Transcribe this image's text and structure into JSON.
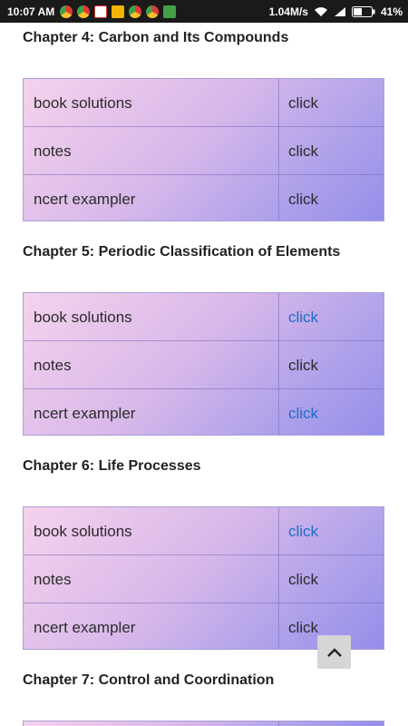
{
  "status_bar": {
    "time": "10:07 AM",
    "speed": "1.04M/s",
    "battery": "41%",
    "icons": [
      "chrome-icon",
      "chrome-icon",
      "gmail-icon",
      "mail-icon",
      "chrome-icon",
      "chrome-icon",
      "updates-icon"
    ]
  },
  "chapters": [
    {
      "title": "Chapter 4: Carbon and Its Compounds",
      "rows": [
        {
          "label": "book solutions",
          "link": "click",
          "visited": false
        },
        {
          "label": "notes",
          "link": "click",
          "visited": false
        },
        {
          "label": "ncert exampler",
          "link": "click",
          "visited": false
        }
      ]
    },
    {
      "title": "Chapter 5: Periodic Classification of Elements",
      "rows": [
        {
          "label": "book solutions",
          "link": "click",
          "visited": true
        },
        {
          "label": "notes",
          "link": "click",
          "visited": false
        },
        {
          "label": "ncert exampler",
          "link": "click",
          "visited": true
        }
      ]
    },
    {
      "title": "Chapter 6: Life Processes",
      "rows": [
        {
          "label": "book solutions",
          "link": "click",
          "visited": true
        },
        {
          "label": "notes",
          "link": "click",
          "visited": false
        },
        {
          "label": "ncert exampler",
          "link": "click",
          "visited": false
        }
      ]
    },
    {
      "title": "Chapter 7: Control and Coordination",
      "rows": []
    }
  ],
  "colors": {
    "link_blue": "#1f6cc7",
    "status_bar": "#1a1a1a"
  }
}
